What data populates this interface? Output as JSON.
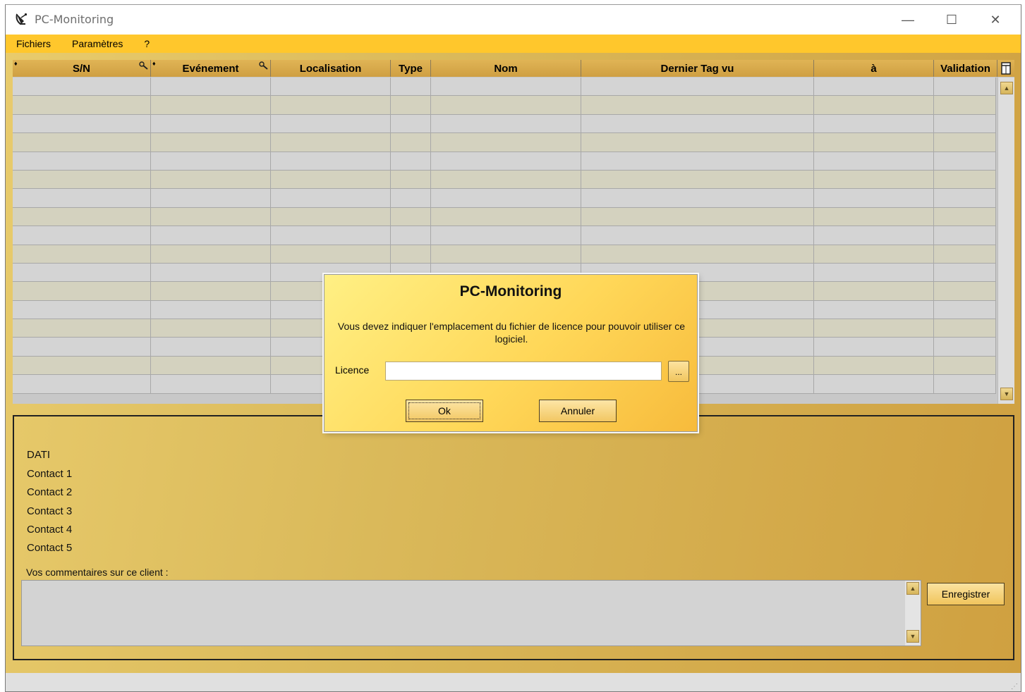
{
  "window": {
    "title": "PC-Monitoring",
    "icon": "satellite-dish-icon",
    "controls": {
      "minimize": "—",
      "maximize": "☐",
      "close": "✕"
    }
  },
  "menu": {
    "items": [
      "Fichiers",
      "Paramètres",
      "?"
    ]
  },
  "grid": {
    "columns": [
      {
        "label": "S/N",
        "sort": "♦",
        "filter": "🔍"
      },
      {
        "label": "Evénement",
        "sort": "♦",
        "filter": "🔍"
      },
      {
        "label": "Localisation"
      },
      {
        "label": "Type"
      },
      {
        "label": "Nom"
      },
      {
        "label": "Dernier Tag vu"
      },
      {
        "label": "à"
      },
      {
        "label": "Validation"
      }
    ],
    "row_count": 17,
    "scroll_up": "▲",
    "scroll_down": "▼"
  },
  "details": {
    "labels": [
      "DATI",
      "Contact 1",
      "Contact 2",
      "Contact 3",
      "Contact 4",
      "Contact 5"
    ],
    "comment_label": "Vos commentaires sur ce client :",
    "comment_value": "",
    "save_button": "Enregistrer"
  },
  "dialog": {
    "title": "PC-Monitoring",
    "message": "Vous devez indiquer l'emplacement du fichier de licence pour pouvoir utiliser ce logiciel.",
    "licence_label": "Licence",
    "licence_value": "",
    "browse_label": "...",
    "ok_label": "Ok",
    "cancel_label": "Annuler"
  },
  "colors": {
    "menubar": "#ffc72c",
    "header": "#d8a94c",
    "row_odd": "#d4d4d4",
    "row_even": "#d4d2bf"
  }
}
